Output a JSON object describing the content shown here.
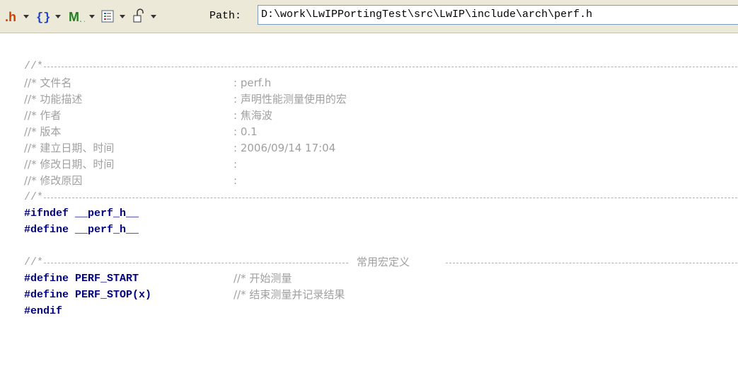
{
  "toolbar": {
    "icons": [
      {
        "name": "header-file-icon",
        "glyph": ".h"
      },
      {
        "name": "braces-icon",
        "glyph": "{}"
      },
      {
        "name": "macro-icon",
        "glyph": "M"
      },
      {
        "name": "list-icon",
        "glyph": "≡"
      },
      {
        "name": "lock-icon",
        "glyph": "🔓"
      }
    ],
    "path_label": "Path:",
    "path_value": "D:\\work\\LwIPPortingTest\\src\\LwIP\\include\\arch\\perf.h"
  },
  "code": {
    "header": [
      {
        "key": "//* 文件名",
        "value": ": perf.h"
      },
      {
        "key": "//* 功能描述",
        "value": ": 声明性能测量使用的宏"
      },
      {
        "key": "//* 作者",
        "value": ": 焦海波"
      },
      {
        "key": "//* 版本",
        "value": ": 0.1"
      },
      {
        "key": "//* 建立日期、时间",
        "value": ": 2006/09/14 17:04"
      },
      {
        "key": "//* 修改日期、时间",
        "value": ":"
      },
      {
        "key": "//* 修改原因",
        "value": ":"
      }
    ],
    "comment_start": "//*",
    "ifndef_kw": "#ifndef",
    "ifndef_name": "__perf_h__",
    "define_kw": "#define",
    "define_name": "__perf_h__",
    "section_title": "常用宏定义",
    "macros": [
      {
        "kw": "#define",
        "name": "PERF_START",
        "comment": "//* 开始测量"
      },
      {
        "kw": "#define",
        "name": "PERF_STOP(x)",
        "comment": "//* 结束测量并记录结果"
      }
    ],
    "endif": "#endif"
  },
  "colors": {
    "comment": "#a0a0a0",
    "preprocessor": "#000080",
    "toolbar": "#ece9d8"
  }
}
